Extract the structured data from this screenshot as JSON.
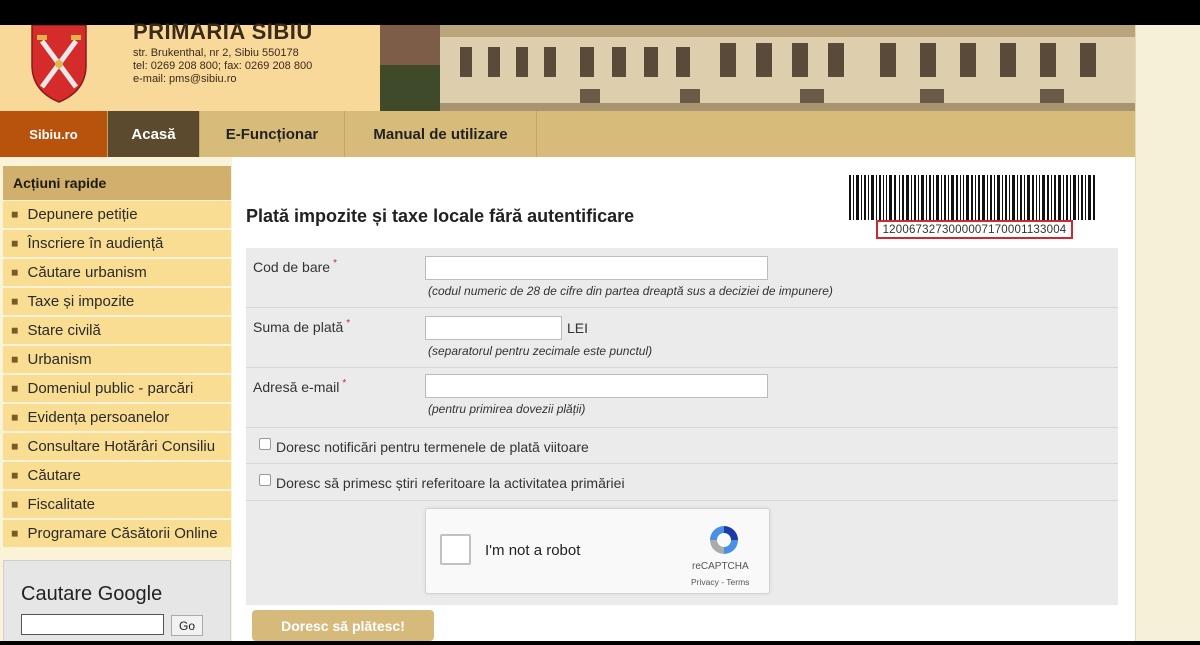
{
  "header": {
    "title": "PRIMARIA SIBIU",
    "address_line": "str. Brukenthal, nr 2, Sibiu 550178",
    "phone_line": "tel: 0269 208 800; fax: 0269 208 800",
    "email_line": "e-mail: pms@sibiu.ro"
  },
  "nav": {
    "items": [
      {
        "label": "Sibiu.ro"
      },
      {
        "label": "Acasă"
      },
      {
        "label": "E-Funcționar"
      },
      {
        "label": "Manual de utilizare"
      }
    ]
  },
  "sidebar": {
    "title": "Acțiuni rapide",
    "items": [
      {
        "label": "Depunere petiție"
      },
      {
        "label": "Înscriere în audiență"
      },
      {
        "label": "Căutare urbanism"
      },
      {
        "label": "Taxe și impozite"
      },
      {
        "label": "Stare civilă"
      },
      {
        "label": "Urbanism"
      },
      {
        "label": "Domeniul public - parcări"
      },
      {
        "label": "Evidența persoanelor"
      },
      {
        "label": "Consultare Hotărâri Consiliu"
      },
      {
        "label": "Căutare"
      },
      {
        "label": "Fiscalitate"
      },
      {
        "label": "Programare Căsătorii Online"
      }
    ],
    "google": {
      "title": "Cautare Google",
      "go_label": "Go"
    }
  },
  "main": {
    "title": "Plată impozite și taxe locale fără autentificare",
    "barcode_number": "1200673273000007170001133004",
    "form": {
      "barcode_label": "Cod de bare",
      "barcode_hint": "(codul numeric de 28 de cifre din partea dreaptă sus a deciziei de impunere)",
      "amount_label": "Suma de plată",
      "amount_unit": "LEI",
      "amount_hint": "(separatorul pentru zecimale este punctul)",
      "email_label": "Adresă e-mail",
      "email_hint": "(pentru primirea dovezii plății)",
      "required_mark": "*",
      "checkbox_notifications": "Doresc notificări pentru termenele de plată viitoare",
      "checkbox_news": "Doresc să primesc știri referitoare la activitatea primăriei"
    },
    "recaptcha": {
      "label": "I'm not a robot",
      "brand": "reCAPTCHA",
      "links": "Privacy - Terms"
    },
    "submit_label": "Doresc să plătesc!"
  },
  "colors": {
    "nav_active": "#b8530e",
    "nav_home": "#5b4a2e",
    "sidebar_item": "#f8dd93",
    "barcode_highlight": "#d3262c",
    "submit": "#d5ba7c"
  }
}
